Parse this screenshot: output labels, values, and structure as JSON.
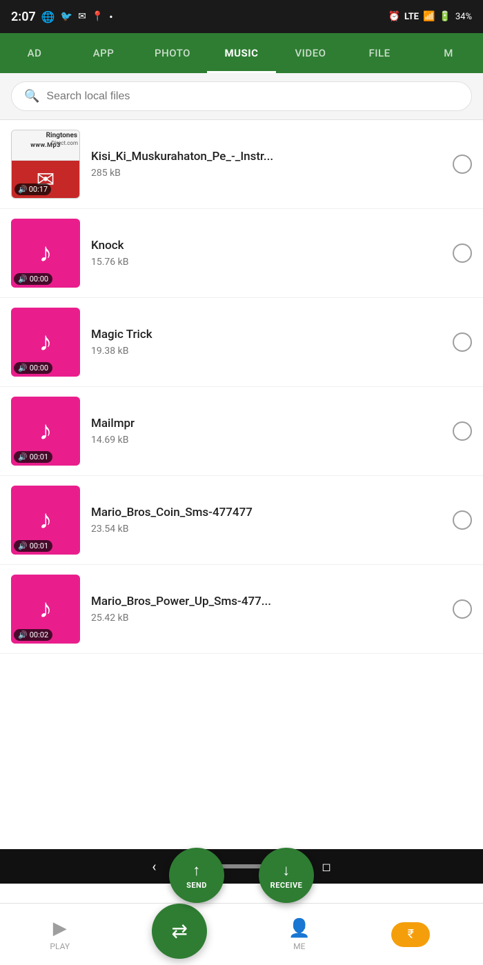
{
  "statusBar": {
    "time": "2:07",
    "batteryLevel": "34%",
    "network": "LTE"
  },
  "navTabs": [
    {
      "id": "ad",
      "label": "AD"
    },
    {
      "id": "app",
      "label": "APP"
    },
    {
      "id": "photo",
      "label": "PHOTO"
    },
    {
      "id": "music",
      "label": "MUSIC",
      "active": true
    },
    {
      "id": "video",
      "label": "VIDEO"
    },
    {
      "id": "file",
      "label": "FILE"
    },
    {
      "id": "more",
      "label": "M"
    }
  ],
  "search": {
    "placeholder": "Search local files"
  },
  "files": [
    {
      "id": 1,
      "name": "Kisi_Ki_Muskurahaton_Pe_-_Instr...",
      "size": "285 kB",
      "duration": "00:17",
      "hasCover": true
    },
    {
      "id": 2,
      "name": "Knock",
      "size": "15.76 kB",
      "duration": "00:00",
      "hasCover": false
    },
    {
      "id": 3,
      "name": "Magic Trick",
      "size": "19.38 kB",
      "duration": "00:00",
      "hasCover": false
    },
    {
      "id": 4,
      "name": "Mailmpr",
      "size": "14.69 kB",
      "duration": "00:01",
      "hasCover": false
    },
    {
      "id": 5,
      "name": "Mario_Bros_Coin_Sms-477477",
      "size": "23.54 kB",
      "duration": "00:01",
      "hasCover": false
    },
    {
      "id": 6,
      "name": "Mario_Bros_Power_Up_Sms-477...",
      "size": "25.42 kB",
      "duration": "00:02",
      "hasCover": false
    }
  ],
  "actionButtons": {
    "send": "SEND",
    "receive": "RECEIVE"
  },
  "bottomNav": {
    "play": "PLAY",
    "me": "ME"
  }
}
